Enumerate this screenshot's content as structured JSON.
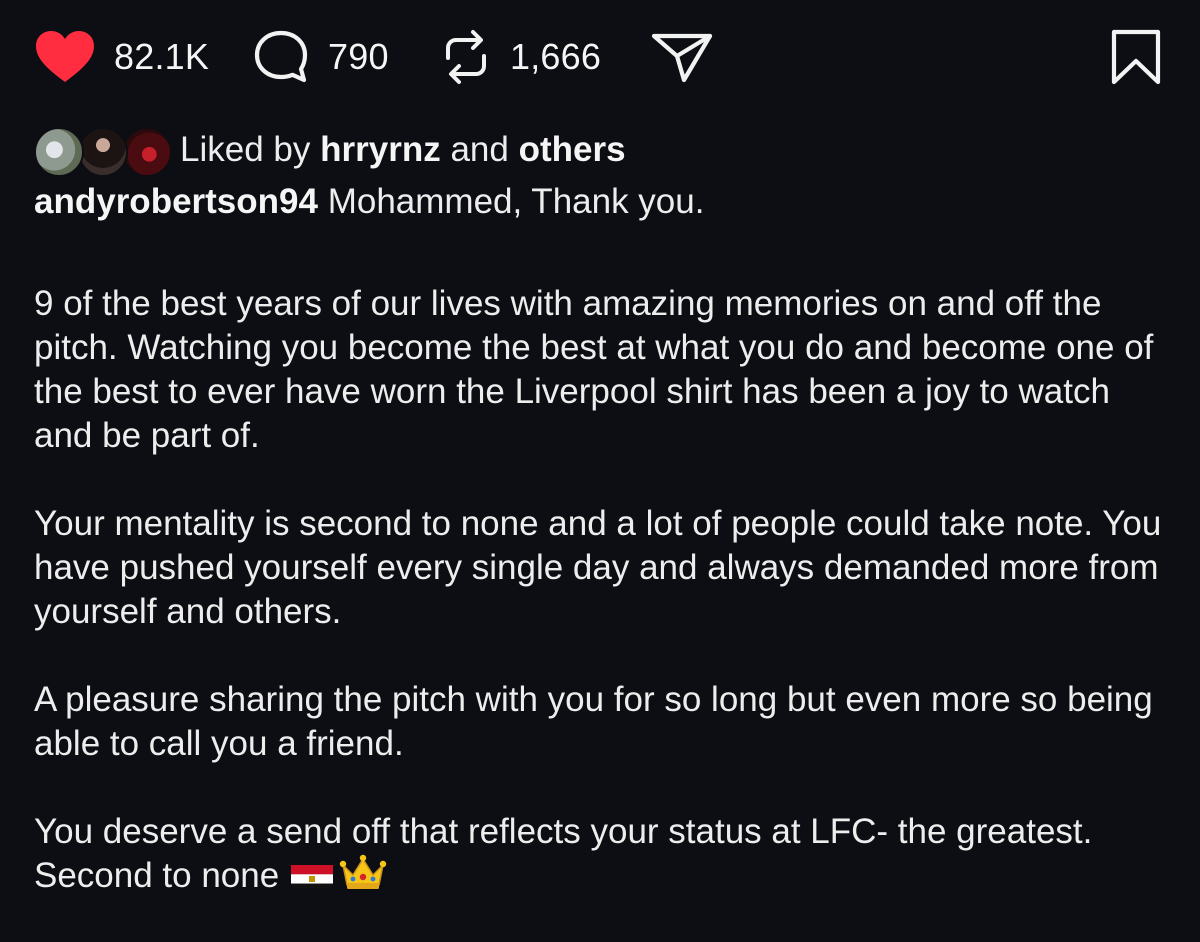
{
  "actions": {
    "likes": "82.1K",
    "comments": "790",
    "reposts": "1,666",
    "like_color": "#ff2d3f"
  },
  "liked_by": {
    "prefix": "Liked by",
    "user": "hrryrnz",
    "conjunction": "and",
    "others": "others"
  },
  "caption": {
    "username": "andyrobertson94",
    "first_line": "Mohammed, Thank you.",
    "paragraphs": [
      "9 of the best years of our lives with amazing memories on and off the pitch. Watching you become the best at what you do and become one of the best to ever have worn the Liverpool shirt has been a joy to watch and be part of.",
      "Your mentality is second to none and a lot of people could take note. You have pushed yourself every single day and always demanded more from yourself and others.",
      "A pleasure sharing the pitch with you for so long but even more so being able to call you a friend.",
      "You deserve a send off that reflects your status at LFC- the greatest. Second to none"
    ],
    "emojis": [
      "egypt-flag-icon",
      "crown-icon"
    ]
  }
}
